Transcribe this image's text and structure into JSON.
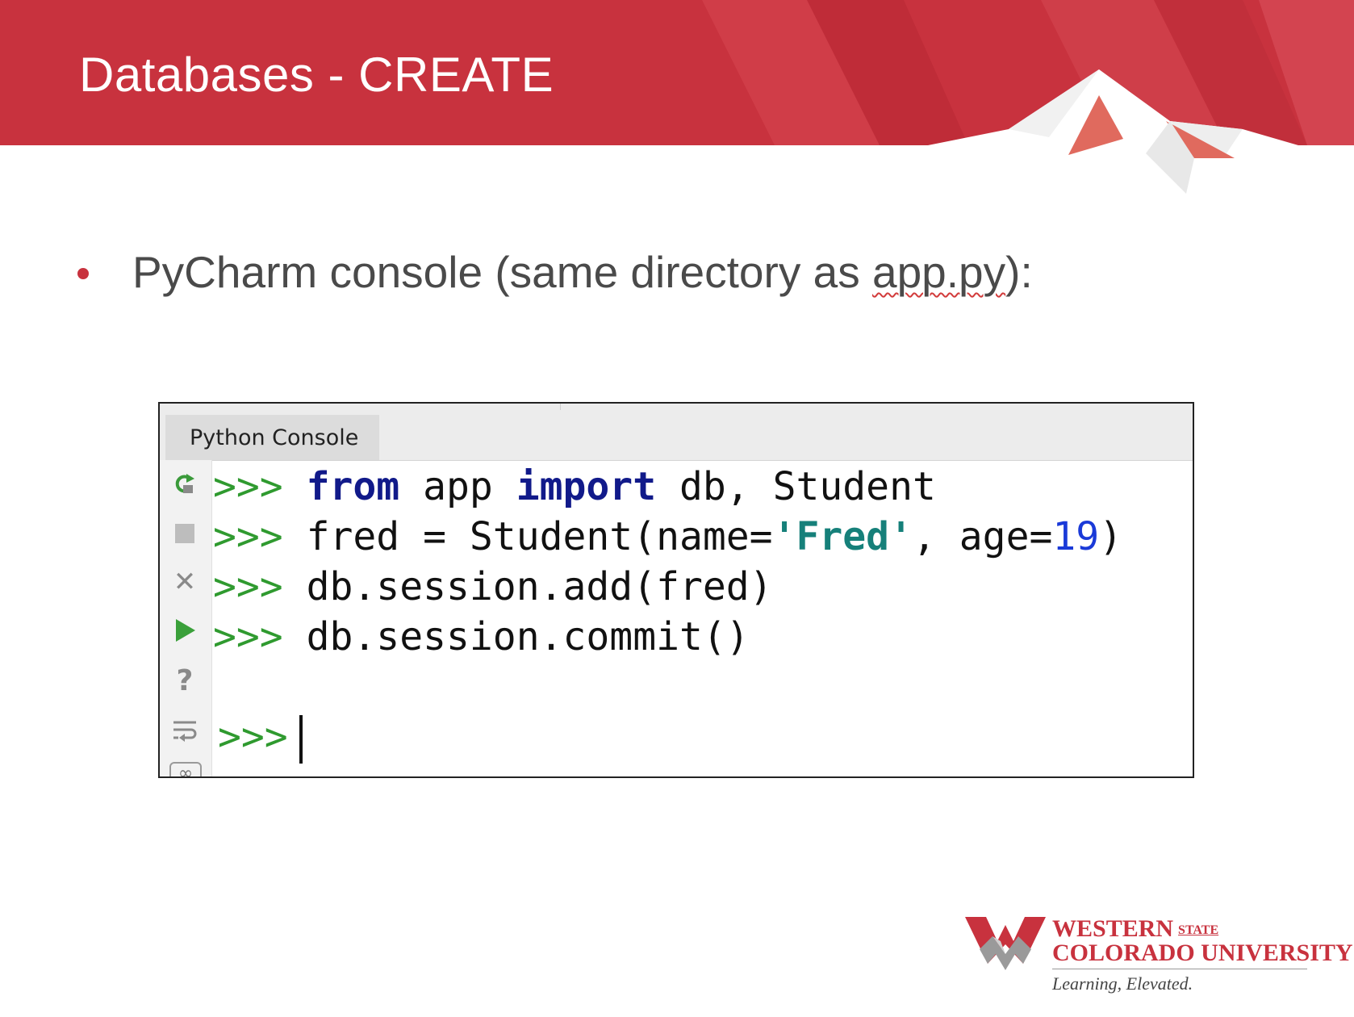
{
  "slide": {
    "title": "Databases - CREATE",
    "bullet_before": "PyCharm console (same directory as ",
    "bullet_file": "app.py",
    "bullet_after": "):"
  },
  "console": {
    "tab_label": "Python Console",
    "prompt": ">>>",
    "lines": {
      "l1": {
        "kw1": "from",
        "t1": " app ",
        "kw2": "import",
        "t2": " db, Student"
      },
      "l2": {
        "t1": "fred = Student(name=",
        "str": "'Fred'",
        "t2": ", age=",
        "num": "19",
        "t3": ")"
      },
      "l3": {
        "t1": "db.session.add(fred)"
      },
      "l4": {
        "t1": "db.session.commit()"
      }
    },
    "gutter_icons": [
      "rerun-icon",
      "stop-icon",
      "close-icon",
      "run-icon",
      "help-icon",
      "soft-wrap-icon",
      "infinity-icon"
    ]
  },
  "logo": {
    "line1": "WESTERN",
    "line1_small": "STATE",
    "line2": "COLORADO UNIVERSITY",
    "tagline": "Learning, Elevated."
  },
  "colors": {
    "brand_red": "#c8323e",
    "prompt_green": "#2f9a2f",
    "keyword_navy": "#111a8a",
    "string_teal": "#16807a",
    "number_blue": "#1a3ad8"
  }
}
